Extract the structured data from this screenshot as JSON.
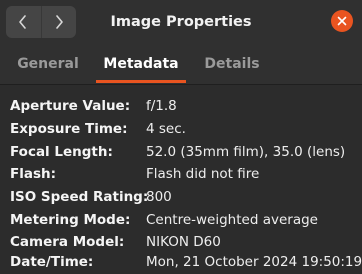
{
  "window": {
    "title": "Image Properties"
  },
  "colors": {
    "accent": "#e95420",
    "background": "#2c2c2c",
    "header": "#303030"
  },
  "header": {
    "back_icon": "chevron-left-icon",
    "forward_icon": "chevron-right-icon",
    "close_icon": "close-icon"
  },
  "tabs": [
    {
      "label": "General",
      "active": false
    },
    {
      "label": "Metadata",
      "active": true
    },
    {
      "label": "Details",
      "active": false
    }
  ],
  "metadata": [
    {
      "label": "Aperture Value:",
      "value": "f/1.8"
    },
    {
      "label": "Exposure Time:",
      "value": "4 sec."
    },
    {
      "label": "Focal Length:",
      "value": "52.0 (35mm film), 35.0 (lens)"
    },
    {
      "label": "Flash:",
      "value": "Flash did not fire"
    },
    {
      "label": "ISO Speed Rating:",
      "value": "800"
    },
    {
      "label": "Metering Mode:",
      "value": "Centre-weighted average"
    },
    {
      "label": "Camera Model:",
      "value": "NIKON D60"
    },
    {
      "label": "Date/Time:",
      "value": "Mon, 21 October 2024  19:50:19"
    }
  ]
}
